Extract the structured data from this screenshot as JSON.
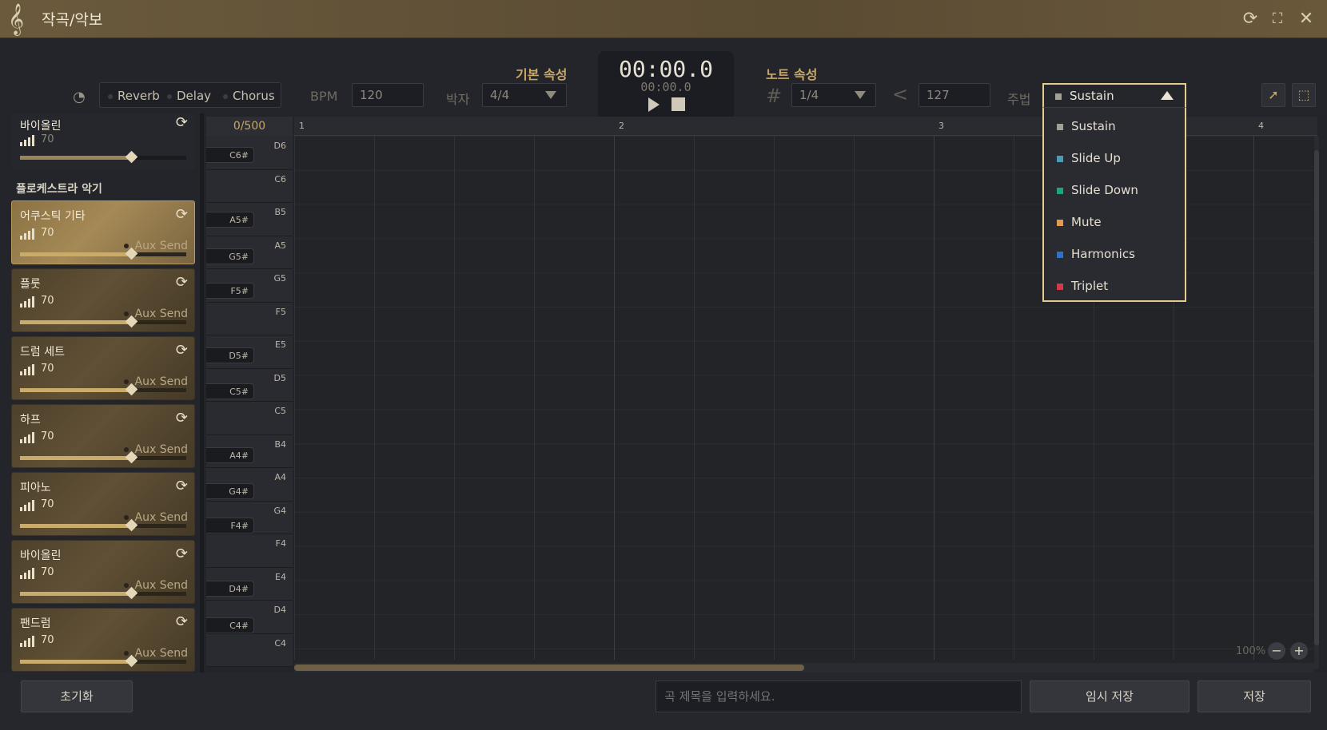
{
  "window": {
    "title": "작곡/악보"
  },
  "effects": [
    "Reverb",
    "Delay",
    "Chorus"
  ],
  "basic": {
    "section_label": "기본 속성",
    "bpm_label": "BPM",
    "bpm_value": "120",
    "meter_label": "박자",
    "meter_value": "4/4"
  },
  "transport": {
    "time_main": "00:00.0",
    "time_sub": "00:00.0"
  },
  "note": {
    "section_label": "노트 속성",
    "grid_value": "1/4",
    "velocity_value": "127",
    "technique_label": "주법",
    "technique_value": "Sustain",
    "technique_options": [
      {
        "label": "Sustain",
        "color": "#a39f96"
      },
      {
        "label": "Slide Up",
        "color": "#4b9bb5"
      },
      {
        "label": "Slide Down",
        "color": "#1fa37a"
      },
      {
        "label": "Mute",
        "color": "#e39a4e"
      },
      {
        "label": "Harmonics",
        "color": "#2f6fc4"
      },
      {
        "label": "Triplet",
        "color": "#d23a4a"
      }
    ]
  },
  "instruments": {
    "top": {
      "name": "바이올린",
      "volume": "70"
    },
    "group_label": "플로케스트라 악기",
    "aux_label": "Aux Send",
    "items": [
      {
        "name": "어쿠스틱 기타",
        "volume": "70",
        "level": 0.67
      },
      {
        "name": "플룻",
        "volume": "70",
        "level": 0.67
      },
      {
        "name": "드럼 세트",
        "volume": "70",
        "level": 0.67
      },
      {
        "name": "하프",
        "volume": "70",
        "level": 0.67
      },
      {
        "name": "피아노",
        "volume": "70",
        "level": 0.67
      },
      {
        "name": "바이올린",
        "volume": "70",
        "level": 0.67
      },
      {
        "name": "팬드럼",
        "volume": "70",
        "level": 0.67
      }
    ]
  },
  "pianoroll": {
    "counter": "0/500",
    "bars": [
      "1",
      "2",
      "3",
      "4"
    ],
    "white_keys": [
      "D6",
      "C6",
      "B5",
      "A5",
      "G5",
      "F5",
      "E5",
      "D5",
      "C5",
      "B4",
      "A4",
      "G4",
      "F4",
      "E4",
      "D4",
      "C4"
    ],
    "black_keys": [
      "C6#",
      "A5#",
      "G5#",
      "F5#",
      "D5#",
      "C5#",
      "A4#",
      "G4#",
      "F4#",
      "D4#",
      "C4#"
    ],
    "zoom": "100%"
  },
  "bottom": {
    "reset_label": "초기화",
    "title_placeholder": "곡 제목을 입력하세요.",
    "temp_save_label": "임시 저장",
    "save_label": "저장"
  }
}
